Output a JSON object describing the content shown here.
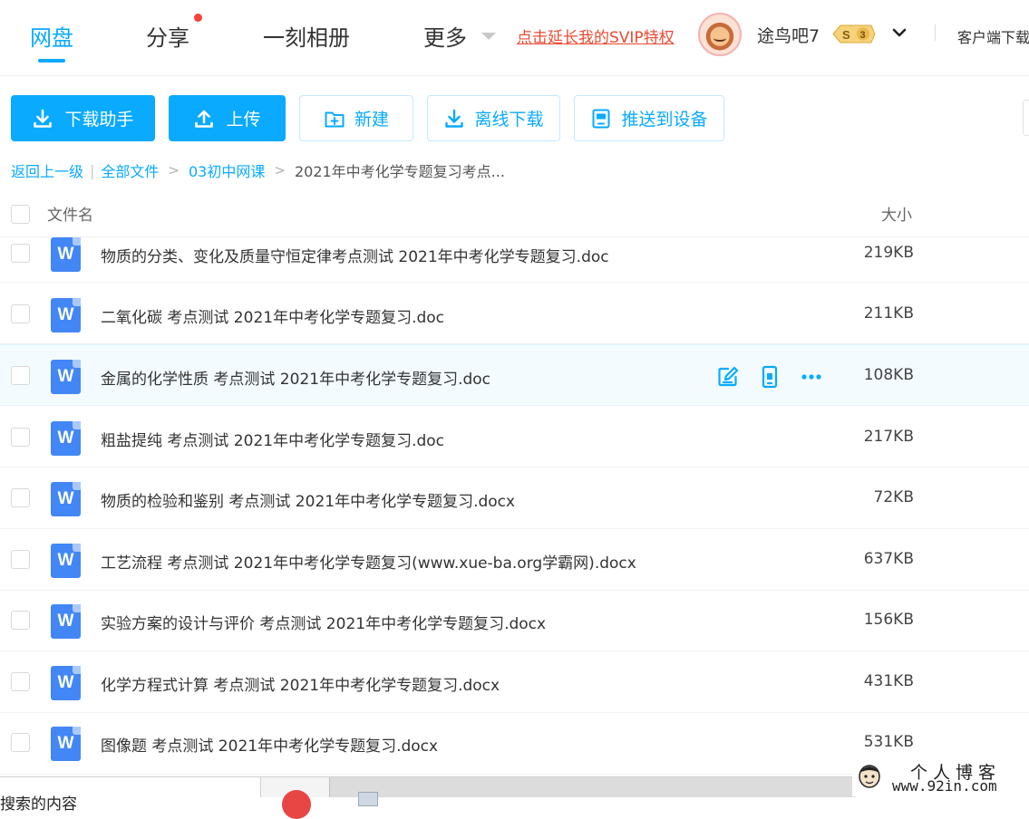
{
  "nav": {
    "tabs": [
      {
        "label": "网盘",
        "active": true
      },
      {
        "label": "分享",
        "has_dot": true
      },
      {
        "label": "一刻相册"
      },
      {
        "label": "更多"
      }
    ],
    "svip_link": "点击延长我的SVIP特权",
    "username": "途鸟吧7",
    "vip_badge": {
      "prefix": "S",
      "level": "3"
    },
    "client_download": "客户端下载"
  },
  "toolbar": {
    "buttons": [
      {
        "label": "下载助手",
        "icon": "download-icon",
        "style": "primary"
      },
      {
        "label": "上传",
        "icon": "upload-icon",
        "style": "primary"
      },
      {
        "label": "新建",
        "icon": "new-folder-icon",
        "style": "secondary"
      },
      {
        "label": "离线下载",
        "icon": "offline-download-icon",
        "style": "secondary"
      },
      {
        "label": "推送到设备",
        "icon": "device-icon",
        "style": "secondary"
      }
    ]
  },
  "breadcrumb": {
    "back": "返回上一级",
    "root": "全部文件",
    "folder": "03初中网课",
    "current": "2021年中考化学专题复习考点..."
  },
  "list": {
    "header_name": "文件名",
    "header_size": "大小",
    "files": [
      {
        "name": "物质的分类、变化及质量守恒定律考点测试 2021年中考化学专题复习.doc",
        "size": "219KB"
      },
      {
        "name": "二氧化碳 考点测试 2021年中考化学专题复习.doc",
        "size": "211KB"
      },
      {
        "name": "金属的化学性质 考点测试 2021年中考化学专题复习.doc",
        "size": "108KB",
        "hover": true
      },
      {
        "name": "粗盐提纯 考点测试 2021年中考化学专题复习.doc",
        "size": "217KB"
      },
      {
        "name": "物质的检验和鉴别 考点测试 2021年中考化学专题复习.docx",
        "size": "72KB"
      },
      {
        "name": "工艺流程 考点测试 2021年中考化学专题复习(www.xue-ba.org学霸网).docx",
        "size": "637KB"
      },
      {
        "name": "实验方案的设计与评价 考点测试 2021年中考化学专题复习.docx",
        "size": "156KB"
      },
      {
        "name": "化学方程式计算 考点测试 2021年中考化学专题复习.docx",
        "size": "431KB"
      },
      {
        "name": "图像题 考点测试 2021年中考化学专题复习.docx",
        "size": "531KB"
      }
    ],
    "file_icon_letter": "W"
  },
  "taskbar": {
    "text": "搜索的内容"
  },
  "watermark": {
    "title": "个人博客",
    "url": "www.92in.com"
  },
  "colors": {
    "accent": "#09aaff",
    "svip_red": "#e94a32",
    "doc_blue": "#4287f5"
  }
}
